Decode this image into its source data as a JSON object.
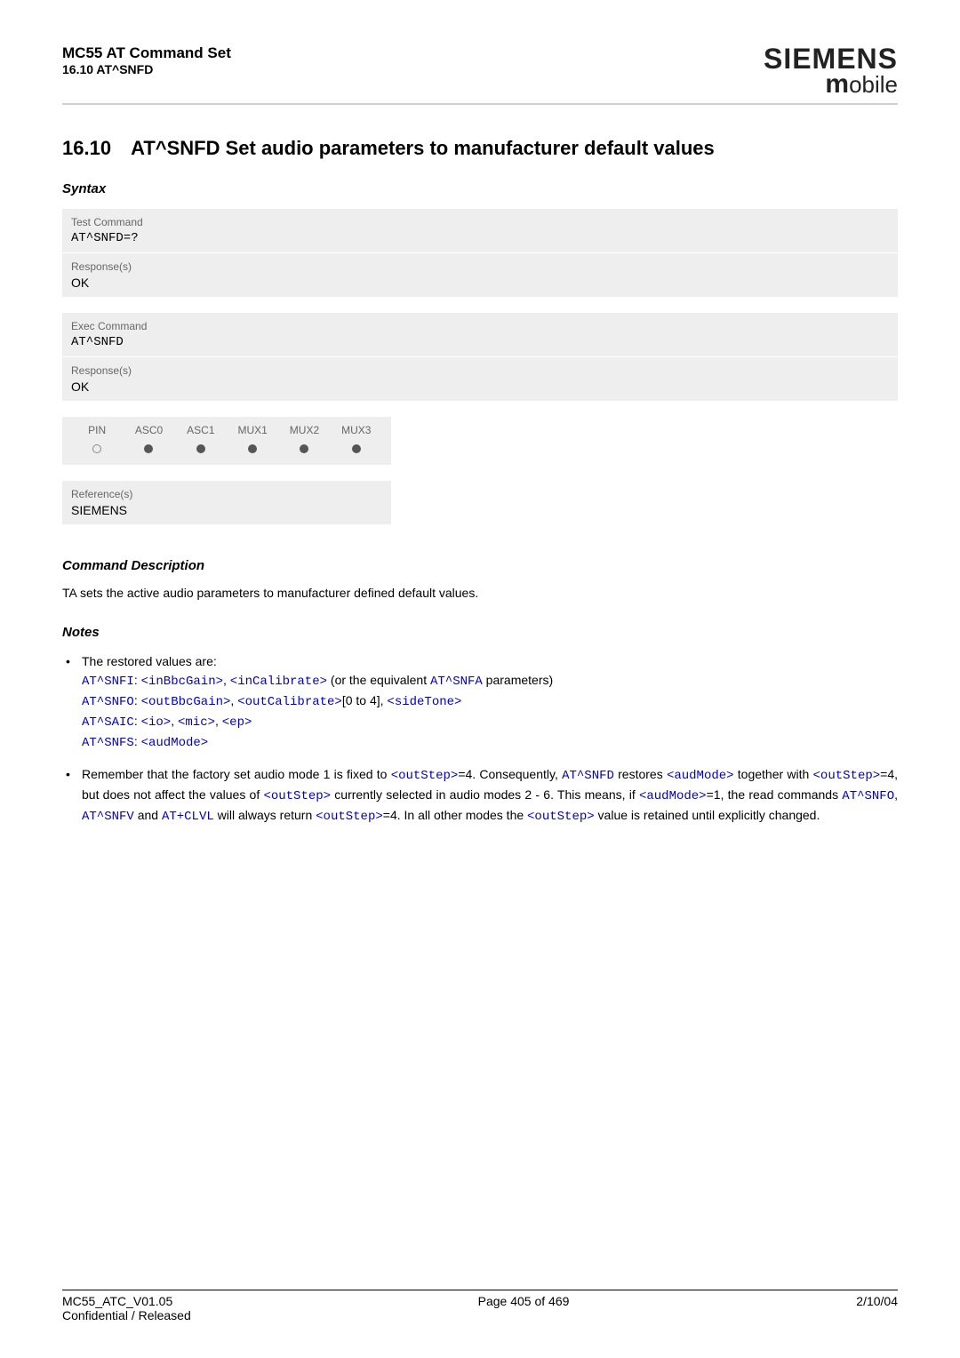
{
  "header": {
    "title": "MC55 AT Command Set",
    "subtitle": "16.10 AT^SNFD",
    "brand_top": "SIEMENS",
    "brand_bottom_m": "m",
    "brand_bottom_rest": "obile"
  },
  "heading": {
    "number": "16.10",
    "text": "AT^SNFD   Set audio parameters to manufacturer default values"
  },
  "syntax_label": "Syntax",
  "test_command": {
    "label": "Test Command",
    "code": "AT^SNFD=?",
    "response_label": "Response(s)",
    "response": "OK"
  },
  "exec_command": {
    "label": "Exec Command",
    "code": "AT^SNFD",
    "response_label": "Response(s)",
    "response": "OK"
  },
  "support": {
    "cols": [
      "PIN",
      "ASC0",
      "ASC1",
      "MUX1",
      "MUX2",
      "MUX3"
    ],
    "filled": [
      false,
      true,
      true,
      true,
      true,
      true
    ]
  },
  "reference": {
    "label": "Reference(s)",
    "value": "SIEMENS"
  },
  "cmd_desc_label": "Command Description",
  "cmd_desc_text": "TA sets the active audio parameters to manufacturer defined default values.",
  "notes_label": "Notes",
  "notes": {
    "note1": {
      "intro": "The restored values are:",
      "l1_cmd": "AT^SNFI",
      "l1_p1": "<inBbcGain>",
      "l1_p2": "<inCalibrate>",
      "l1_tail_a": " (or the equivalent ",
      "l1_tail_b": "AT^SNFA",
      "l1_tail_c": " parameters)",
      "l2_cmd": "AT^SNFO",
      "l2_p1": "<outBbcGain>",
      "l2_p2": "<outCalibrate>",
      "l2_mid": "[0 to 4], ",
      "l2_p3": "<sideTone>",
      "l3_cmd": "AT^SAIC",
      "l3_p1": "<io>",
      "l3_p2": "<mic>",
      "l3_p3": "<ep>",
      "l4_cmd": "AT^SNFS",
      "l4_p1": "<audMode>"
    },
    "note2": {
      "t1": "Remember that the factory set audio mode 1 is fixed to ",
      "p1": "<outStep>",
      "t2": "=4. Consequently, ",
      "p2": "AT^SNFD",
      "t3": " restores ",
      "p3": "<audMode>",
      "t4": " together with ",
      "p4": "<outStep>",
      "t5": "=4, but does not affect the values of ",
      "p5": "<outStep>",
      "t6": " currently selected in audio modes 2 - 6. This means, if ",
      "p6": "<audMode>",
      "t7": "=1, the read commands ",
      "p7": "AT^SNFO",
      "t8": ", ",
      "p8": "AT^SNFV",
      "t9": " and ",
      "p9": "AT+CLVL",
      "t10": " will always return ",
      "p10": "<outStep>",
      "t11": "=4. In all other modes the ",
      "p11": "<outStep>",
      "t12": " value is retained until explicitly changed."
    }
  },
  "footer": {
    "left1": "MC55_ATC_V01.05",
    "left2": "Confidential / Released",
    "center": "Page 405 of 469",
    "right": "2/10/04"
  }
}
